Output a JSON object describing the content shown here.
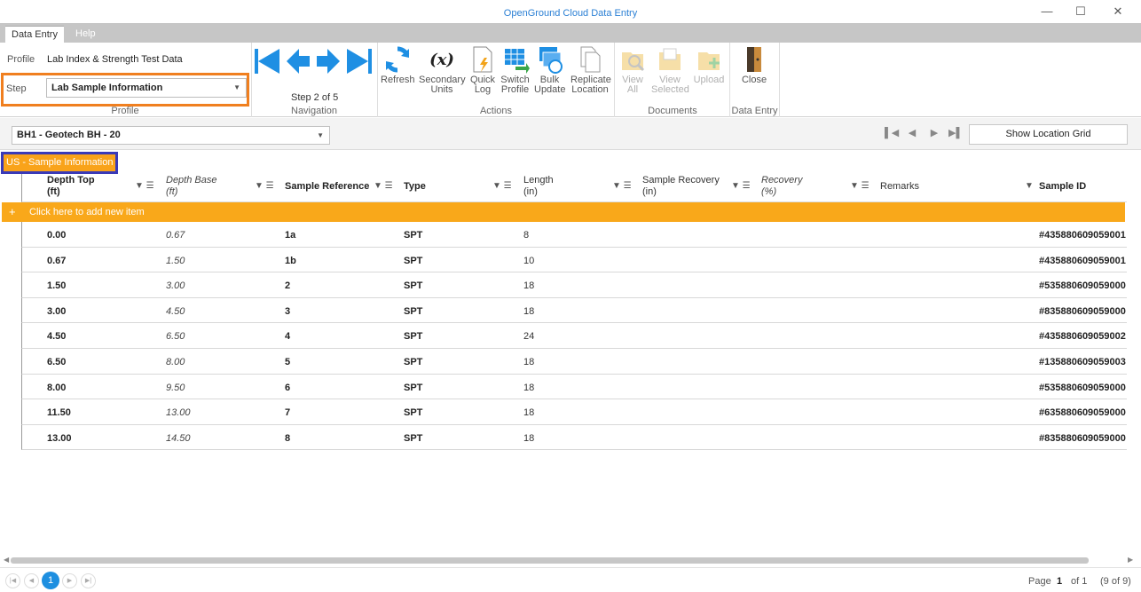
{
  "window": {
    "title": "OpenGround Cloud Data Entry"
  },
  "tabs": [
    {
      "label": "Data Entry"
    },
    {
      "label": "Help"
    }
  ],
  "ribbon": {
    "profile": {
      "label": "Profile",
      "value": "Lab Index & Strength Test Data"
    },
    "step": {
      "label": "Step",
      "value": "Lab Sample Information"
    },
    "profile_group_label": "Profile",
    "navigation": {
      "step_text": "Step 2 of 5",
      "group_label": "Navigation"
    },
    "actions": {
      "group_label": "Actions",
      "refresh": [
        "Refresh"
      ],
      "secondary_units": [
        "Secondary",
        "Units"
      ],
      "quick_log": [
        "Quick",
        "Log"
      ],
      "switch_profile": [
        "Switch",
        "Profile"
      ],
      "bulk_update": [
        "Bulk",
        "Update"
      ],
      "replicate_location": [
        "Replicate",
        "Location"
      ]
    },
    "documents": {
      "group_label": "Documents",
      "view_all": [
        "View",
        "All"
      ],
      "view_selected": [
        "View",
        "Selected"
      ],
      "upload": [
        "Upload"
      ]
    },
    "data_entry": {
      "group_label": "Data Entry",
      "close": "Close"
    }
  },
  "location": {
    "value": "BH1 - Geotech BH - 20",
    "show_grid": "Show Location Grid"
  },
  "group_badge": "US - Sample Information",
  "grid": {
    "headers": [
      {
        "line1": "Depth Top",
        "line2": "(ft)"
      },
      {
        "line1": "Depth Base",
        "line2": "(ft)"
      },
      {
        "line1": "Sample Reference",
        "line2": ""
      },
      {
        "line1": "Type",
        "line2": ""
      },
      {
        "line1": "Length",
        "line2": "(in)"
      },
      {
        "line1": "Sample Recovery",
        "line2": "(in)"
      },
      {
        "line1": "Recovery",
        "line2": "(%)"
      },
      {
        "line1": "Remarks",
        "line2": ""
      },
      {
        "line1": "Sample ID",
        "line2": ""
      }
    ],
    "add_row": "Click here to add new item",
    "rows": [
      {
        "depth_top": "0.00",
        "depth_base": "0.67",
        "sample_ref": "1a",
        "type": "SPT",
        "length": "8",
        "sample_id": "#435880609059001"
      },
      {
        "depth_top": "0.67",
        "depth_base": "1.50",
        "sample_ref": "1b",
        "type": "SPT",
        "length": "10",
        "sample_id": "#435880609059001"
      },
      {
        "depth_top": "1.50",
        "depth_base": "3.00",
        "sample_ref": "2",
        "type": "SPT",
        "length": "18",
        "sample_id": "#535880609059000"
      },
      {
        "depth_top": "3.00",
        "depth_base": "4.50",
        "sample_ref": "3",
        "type": "SPT",
        "length": "18",
        "sample_id": "#835880609059000"
      },
      {
        "depth_top": "4.50",
        "depth_base": "6.50",
        "sample_ref": "4",
        "type": "SPT",
        "length": "24",
        "sample_id": "#435880609059002"
      },
      {
        "depth_top": "6.50",
        "depth_base": "8.00",
        "sample_ref": "5",
        "type": "SPT",
        "length": "18",
        "sample_id": "#135880609059003"
      },
      {
        "depth_top": "8.00",
        "depth_base": "9.50",
        "sample_ref": "6",
        "type": "SPT",
        "length": "18",
        "sample_id": "#535880609059000"
      },
      {
        "depth_top": "11.50",
        "depth_base": "13.00",
        "sample_ref": "7",
        "type": "SPT",
        "length": "18",
        "sample_id": "#635880609059000"
      },
      {
        "depth_top": "13.00",
        "depth_base": "14.50",
        "sample_ref": "8",
        "type": "SPT",
        "length": "18",
        "sample_id": "#835880609059000"
      }
    ]
  },
  "pager": {
    "current": "1",
    "page_label": "Page",
    "page_num": "1",
    "of_label": "of 1",
    "count": "(9 of 9)"
  },
  "colors": {
    "accent": "#1e8fe0",
    "orange": "#f9a81a",
    "highlight_step": "#f07f1f",
    "highlight_badge": "#3a3ab8"
  }
}
